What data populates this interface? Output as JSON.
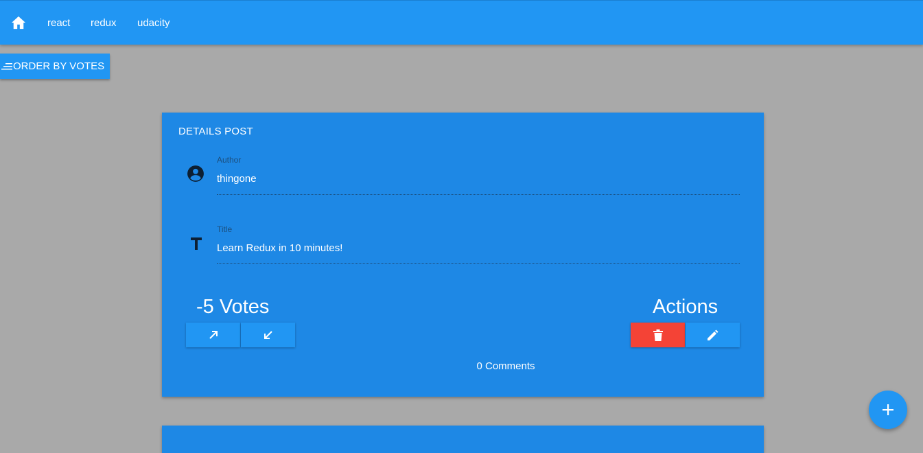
{
  "nav": {
    "home_icon": "home-icon",
    "links": [
      "react",
      "redux",
      "udacity"
    ]
  },
  "toolbar": {
    "order_label": "ORDER BY VOTES",
    "order_icon": "sort-icon"
  },
  "post": {
    "header": "DETAILS POST",
    "author_label": "Author",
    "author_value": "thingone",
    "title_label": "Title",
    "title_value": "Learn Redux in 10 minutes!",
    "votes_text": "-5 Votes",
    "actions_text": "Actions",
    "comments_text": "0 Comments"
  },
  "colors": {
    "appbar": "#2196f3",
    "card": "#1e88e5",
    "delete": "#f44336",
    "background": "#a9a9a9"
  },
  "fab": {
    "icon": "add-icon"
  }
}
